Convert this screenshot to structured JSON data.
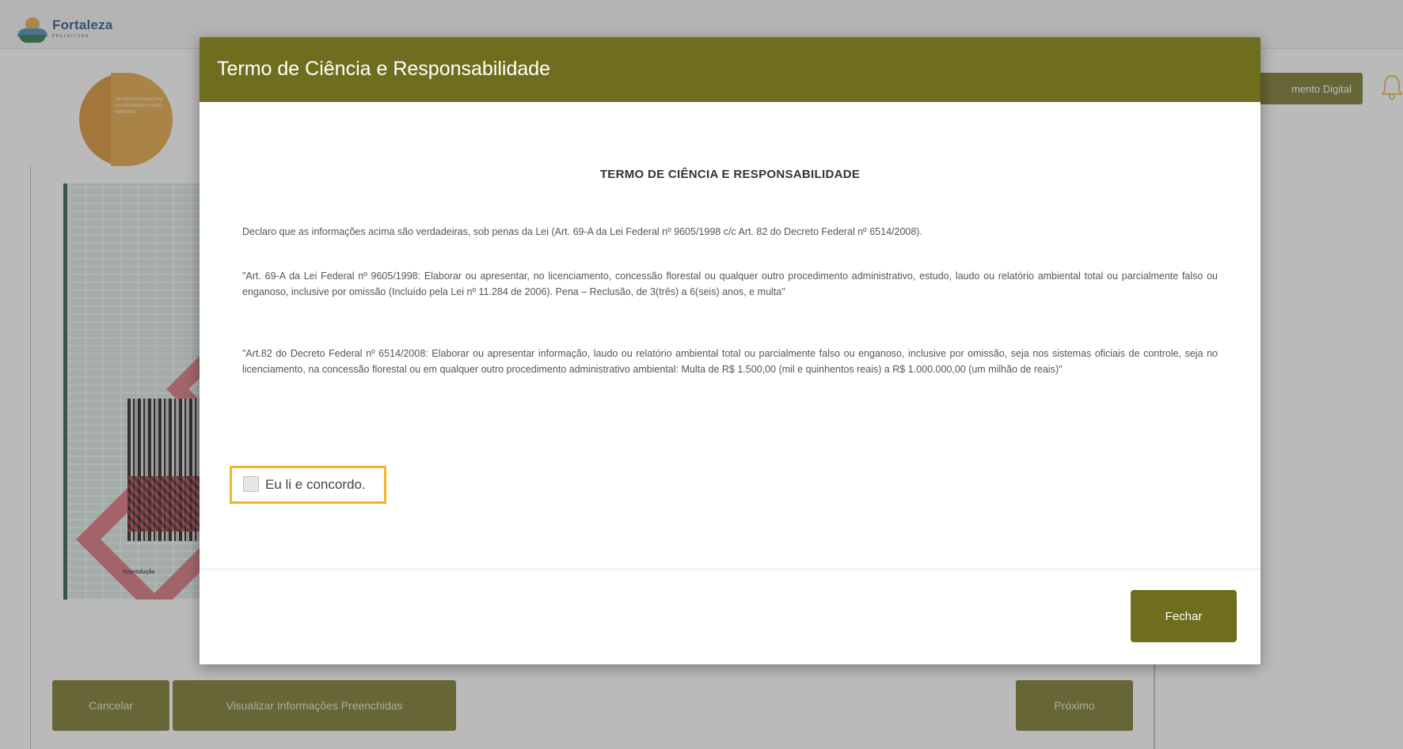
{
  "topbar": {
    "logo_title": "Fortaleza",
    "logo_sub": "PREFEITURA"
  },
  "header": {
    "digital_button_label": "mento Digital"
  },
  "brand": {
    "text": "SECRETARIA MUNICIPAL DO URBANISMO E MEIO AMBIENTE"
  },
  "preview": {
    "footer_text": "Reprodução"
  },
  "bottom_actions": {
    "cancel_label": "Cancelar",
    "view_info_label": "Visualizar Informações Preenchidas",
    "next_label": "Próximo"
  },
  "modal": {
    "title": "Termo de Ciência e Responsabilidade",
    "heading": "TERMO DE CIÊNCIA E RESPONSABILIDADE",
    "paragraph_1": "Declaro que as informações acima são verdadeiras, sob penas da Lei (Art. 69-A da Lei Federal nº 9605/1998 c/c Art. 82 do Decreto Federal nº 6514/2008).",
    "paragraph_2": "\"Art. 69-A da Lei Federal nº 9605/1998: Elaborar ou apresentar, no licenciamento, concessão florestal ou qualquer outro procedimento administrativo, estudo, laudo ou relatório ambiental total ou parcialmente falso ou enganoso, inclusive por omissão (Incluído pela Lei nº 11.284 de 2006). Pena – Reclusão, de 3(três) a 6(seis) anos, e multa\"",
    "paragraph_3": "\"Art.82 do Decreto Federal nº 6514/2008: Elaborar ou apresentar informação, laudo ou relatório ambiental total ou parcialmente falso ou enganoso, inclusive por omissão, seja nos sistemas oficiais de controle, seja no licenciamento, na concessão florestal ou em qualquer outro procedimento administrativo ambiental: Multa de R$ 1.500,00 (mil e quinhentos reais) a R$ 1.000.000,00 (um milhão de reais)\"",
    "agree_label": "Eu li e concordo.",
    "agree_checked": false,
    "close_label": "Fechar"
  },
  "colors": {
    "accent": "#6f6e1e",
    "highlight": "#f2b32b"
  }
}
